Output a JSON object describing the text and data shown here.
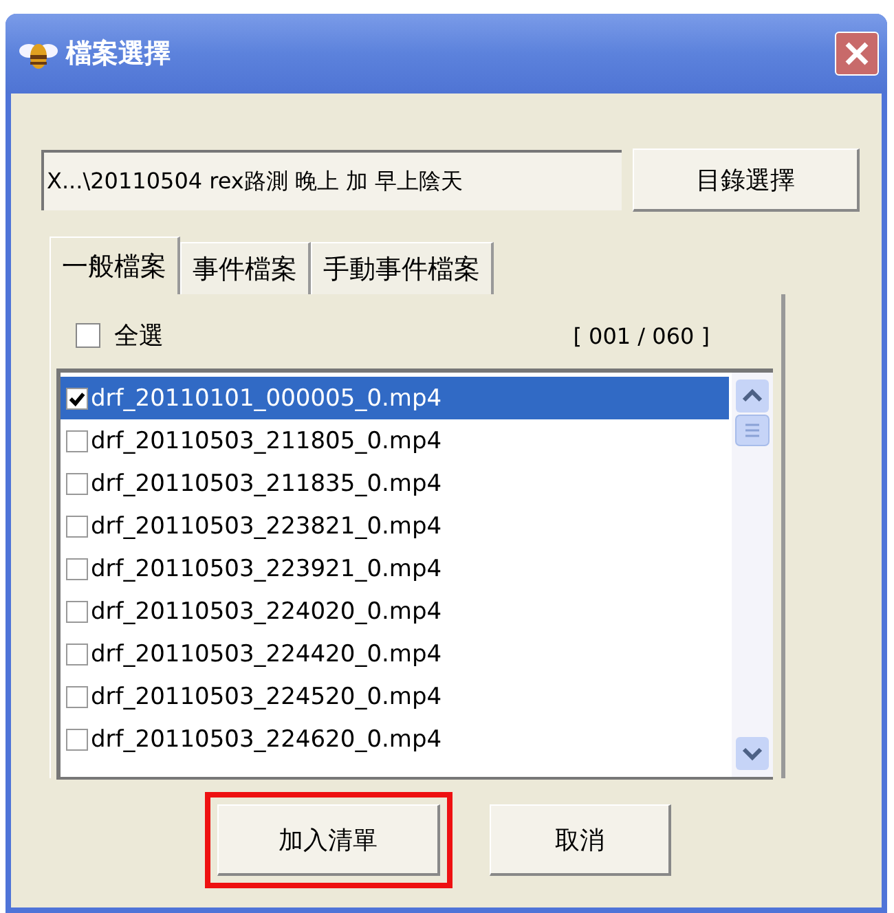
{
  "window": {
    "title": "檔案選擇"
  },
  "path": {
    "value": "X...\\20110504 rex路測 晚上 加 早上陰天"
  },
  "browse_button": {
    "label": "目錄選擇"
  },
  "tabs": [
    {
      "label": "一般檔案",
      "selected": true
    },
    {
      "label": "事件檔案",
      "selected": false
    },
    {
      "label": "手動事件檔案",
      "selected": false
    }
  ],
  "select_all": {
    "label": "全選",
    "checked": false
  },
  "counter": "[ 001 / 060 ]",
  "files": [
    {
      "name": "drf_20110101_000005_0.mp4",
      "checked": true,
      "selected": true
    },
    {
      "name": "drf_20110503_211805_0.mp4",
      "checked": false,
      "selected": false
    },
    {
      "name": "drf_20110503_211835_0.mp4",
      "checked": false,
      "selected": false
    },
    {
      "name": "drf_20110503_223821_0.mp4",
      "checked": false,
      "selected": false
    },
    {
      "name": "drf_20110503_223921_0.mp4",
      "checked": false,
      "selected": false
    },
    {
      "name": "drf_20110503_224020_0.mp4",
      "checked": false,
      "selected": false
    },
    {
      "name": "drf_20110503_224420_0.mp4",
      "checked": false,
      "selected": false
    },
    {
      "name": "drf_20110503_224520_0.mp4",
      "checked": false,
      "selected": false
    },
    {
      "name": "drf_20110503_224620_0.mp4",
      "checked": false,
      "selected": false
    }
  ],
  "buttons": [
    {
      "label": "加入清單",
      "highlighted": true
    },
    {
      "label": "取消",
      "highlighted": false
    }
  ]
}
